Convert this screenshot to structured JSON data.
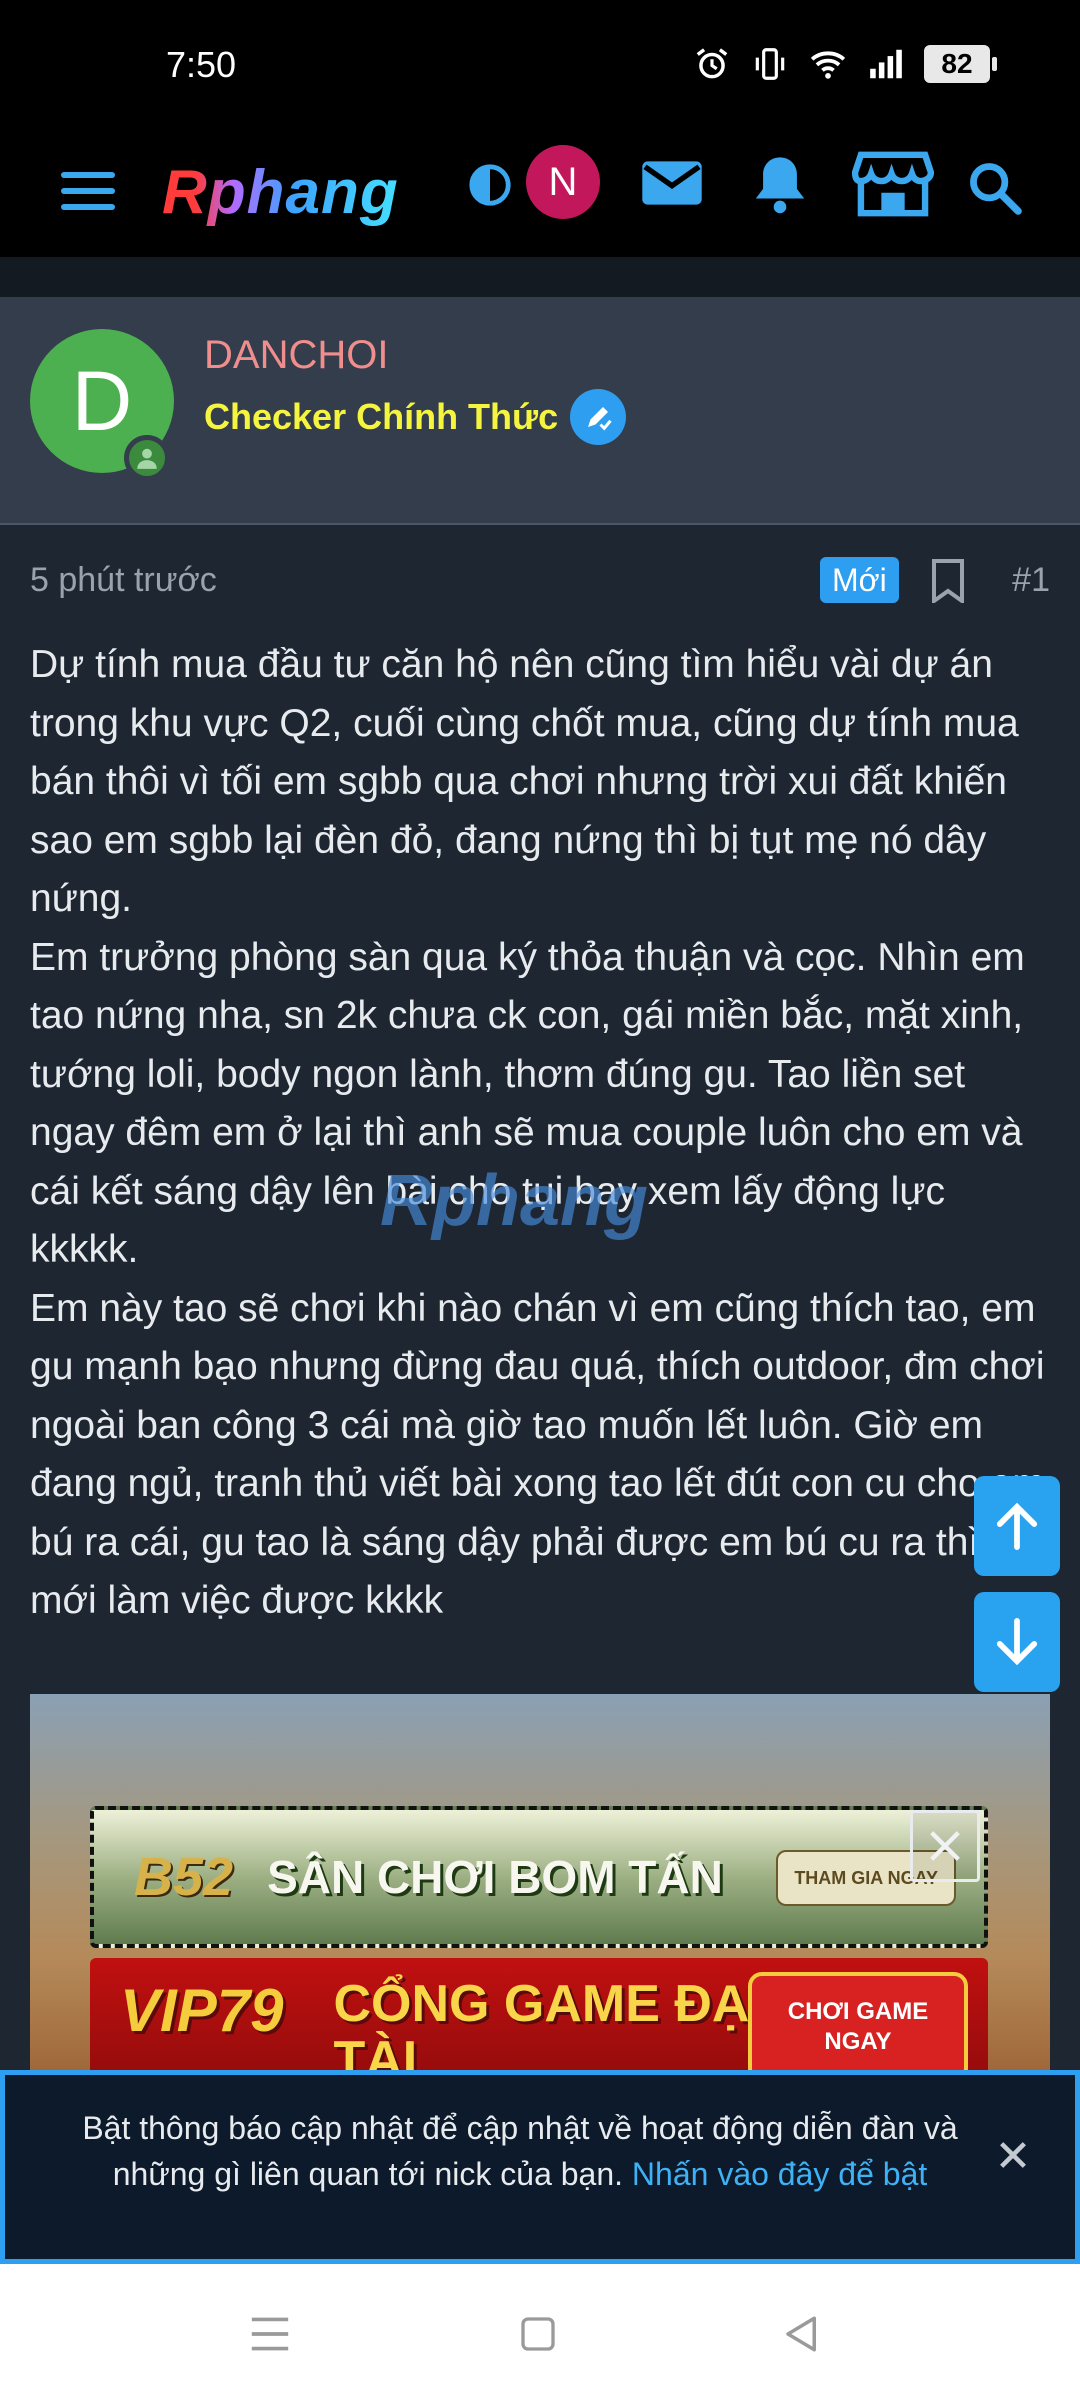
{
  "status_bar": {
    "time": "7:50",
    "battery": "82",
    "icons": [
      "alarm-icon",
      "vibrate-icon",
      "wifi-icon",
      "signal-icon",
      "battery-icon"
    ]
  },
  "app_bar": {
    "logo_text": "Rphang",
    "user_initial": "N",
    "icons": [
      "menu-icon",
      "theme-toggle-icon",
      "mail-icon",
      "bell-icon",
      "store-icon",
      "search-icon"
    ]
  },
  "user": {
    "initial": "D",
    "name": "DANCHOI",
    "title": "Checker Chính Thức"
  },
  "post": {
    "time_ago": "5 phút trước",
    "badge": "Mới",
    "number": "#1",
    "paragraphs": [
      "Dự tính mua đầu tư căn hộ nên cũng tìm hiểu vài dự án trong khu vực Q2, cuối cùng chốt mua, cũng dự tính mua bán thôi vì tối em sgbb qua chơi nhưng trời xui đất khiến sao em sgbb lại đèn đỏ, đang nứng thì bị tụt mẹ nó dây nứng.",
      "Em trưởng phòng sàn qua ký thỏa thuận và cọc. Nhìn em tao nứng nha, sn 2k chưa ck con, gái miền bắc, mặt xinh, tướng loli, body ngon lành, thơm đúng gu. Tao liền set ngay đêm em ở lại thì anh sẽ mua couple luôn cho em và cái kết sáng dậy lên bài cho tụi bay xem lấy động lực kkkkk.",
      "Em này tao sẽ chơi khi nào chán vì em cũng thích tao, em gu mạnh bạo nhưng đừng đau quá, thích outdoor, đm chơi ngoài ban công 3 cái mà giờ tao muốn lết luôn. Giờ em đang ngủ, tranh thủ viết bài xong tao lết đút con cu cho em bú ra cái, gu tao là sáng dậy phải được em bú cu ra thì tao mới làm việc được kkkk"
    ],
    "watermark": "Rphang"
  },
  "ads": {
    "ad1": {
      "brand": "B52",
      "slogan": "SÂN CHƠI BOM TẤN",
      "cta": "THAM GIA NGAY"
    },
    "ad2": {
      "brand": "VIP79",
      "slogan": "CỔNG GAME ĐẠI THẦN TÀI",
      "cta": "CHƠI GAME NGAY"
    }
  },
  "notification": {
    "text": "Bật thông báo cập nhật để cập nhật về hoạt động diễn đàn và những gì liên quan tới nick của bạn.",
    "link": "Nhấn vào đây để bật"
  },
  "colors": {
    "accent": "#2e9ef0",
    "username": "#f08d8d",
    "title": "#f5f540",
    "background": "#1e2632"
  }
}
